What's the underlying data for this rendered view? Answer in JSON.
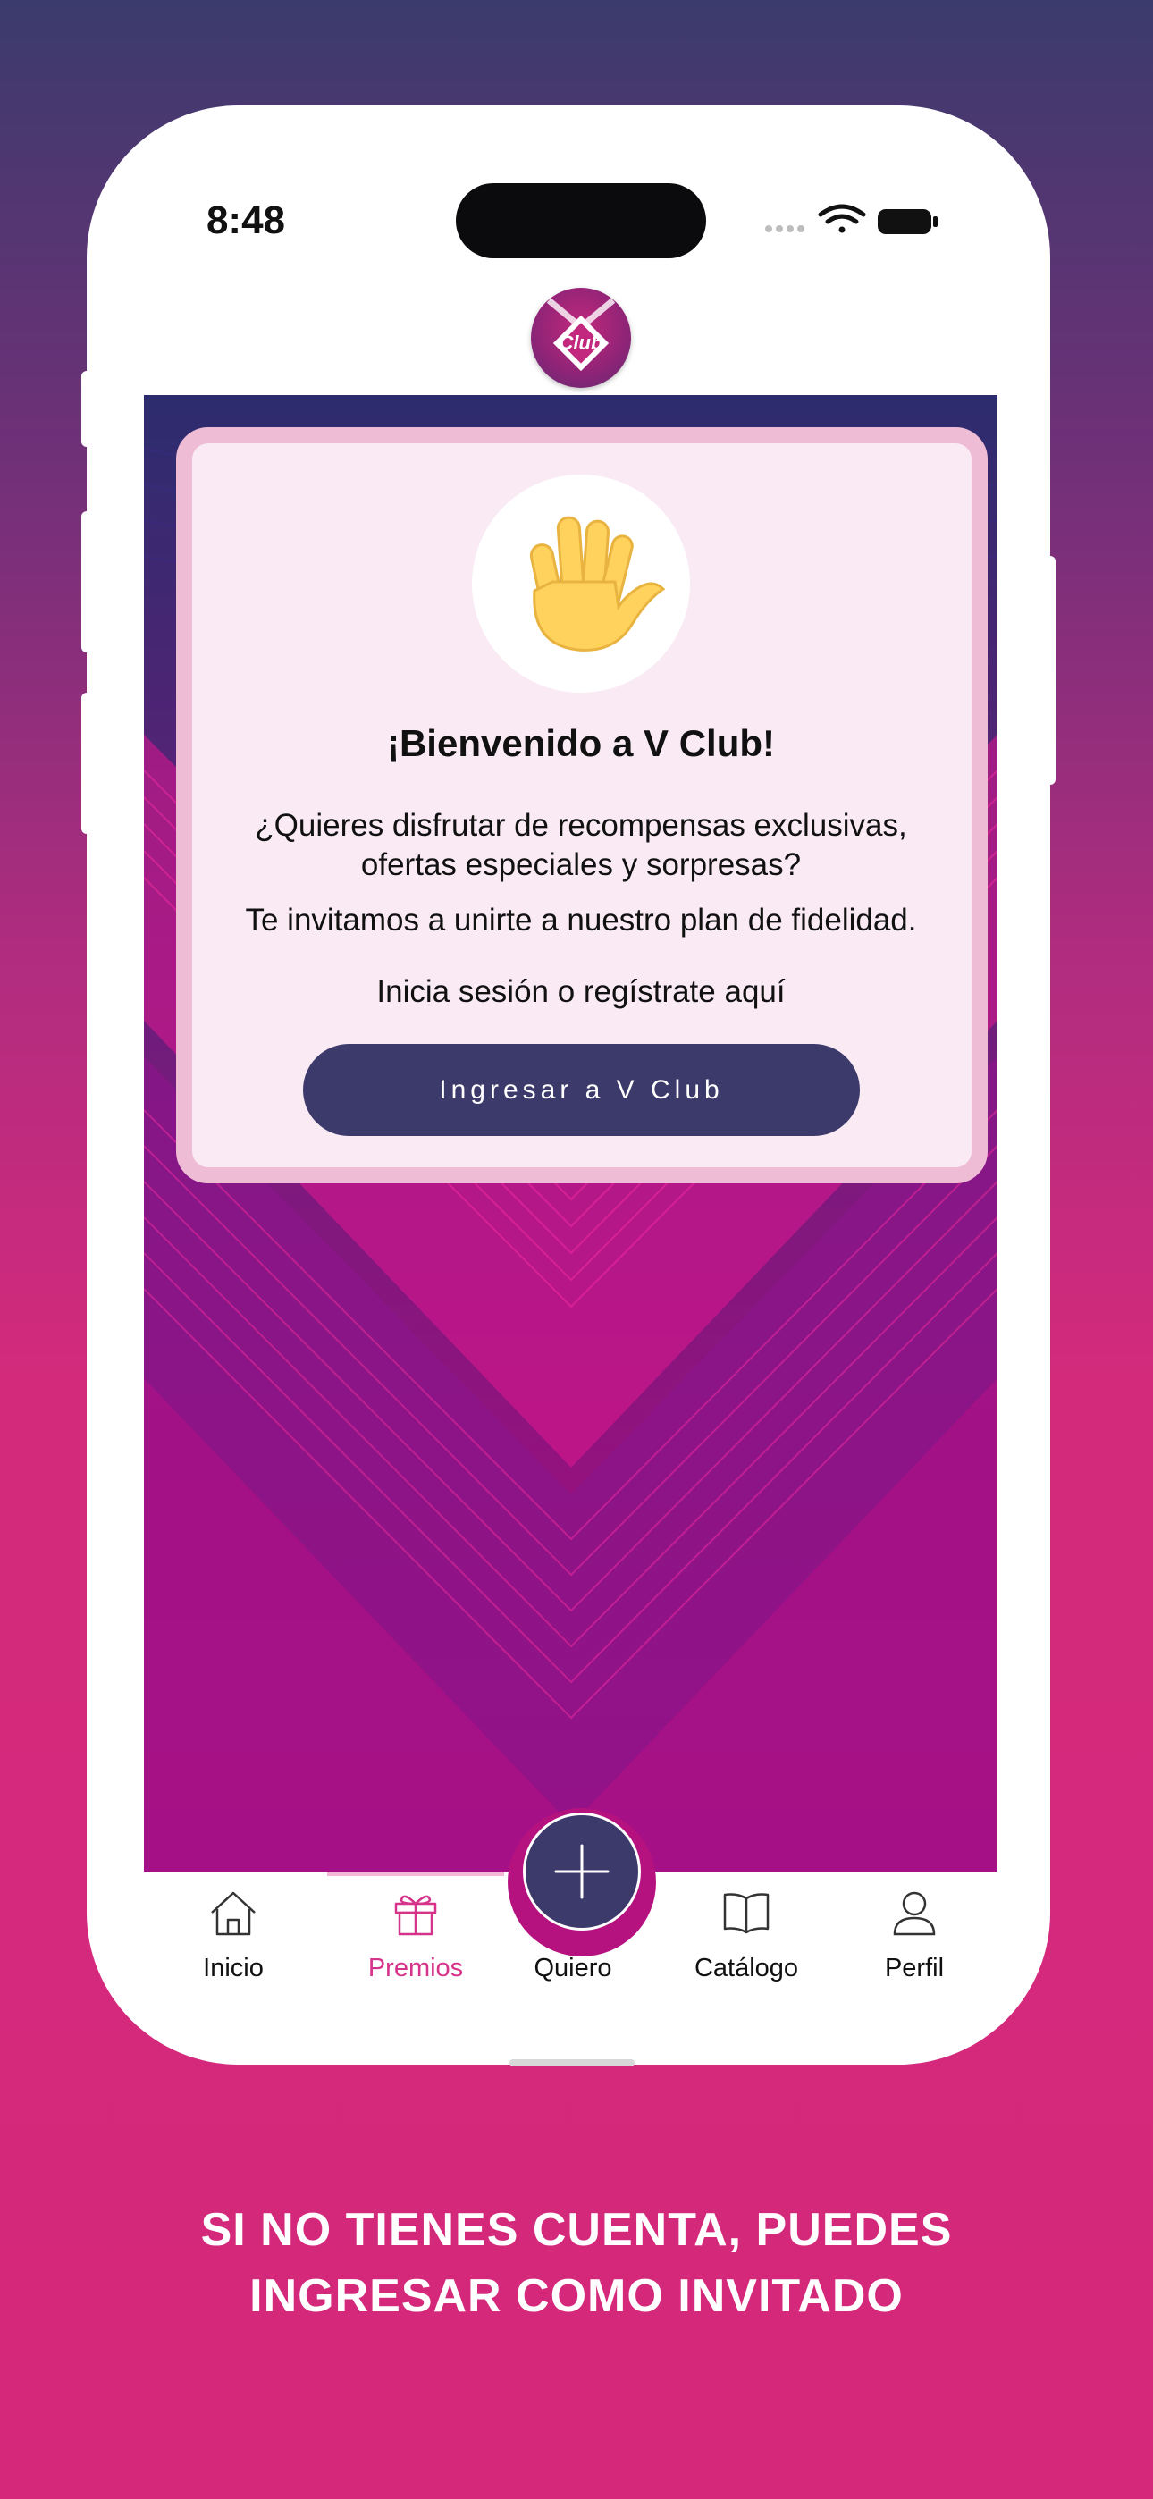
{
  "status_bar": {
    "time": "8:48"
  },
  "logo": {
    "name": "Club"
  },
  "welcome_card": {
    "icon": "waving-hand-icon",
    "title": "¡Bienvenido a V Club!",
    "line1": "¿Quieres disfrutar de recompensas exclusivas, ofertas especiales y sorpresas?",
    "line2": "Te invitamos a unirte a nuestro plan de fidelidad.",
    "line3": "Inicia sesión o regístrate aquí",
    "button": "Ingresar a V Club"
  },
  "tabs": [
    {
      "label": "Inicio",
      "icon": "home-icon",
      "active": false
    },
    {
      "label": "Premios",
      "icon": "gift-icon",
      "active": true
    },
    {
      "label": "Quiero",
      "icon": "plus-icon",
      "active": false
    },
    {
      "label": "Catálogo",
      "icon": "book-icon",
      "active": false
    },
    {
      "label": "Perfil",
      "icon": "user-icon",
      "active": false
    }
  ],
  "colors": {
    "accent": "#d6338a",
    "primary_button": "#3c3a6b",
    "card_bg": "#f9eaf3",
    "card_border": "#efbcd6"
  },
  "caption": {
    "line1": "SI NO TIENES CUENTA, PUEDES",
    "line2": "INGRESAR COMO INVITADO"
  }
}
